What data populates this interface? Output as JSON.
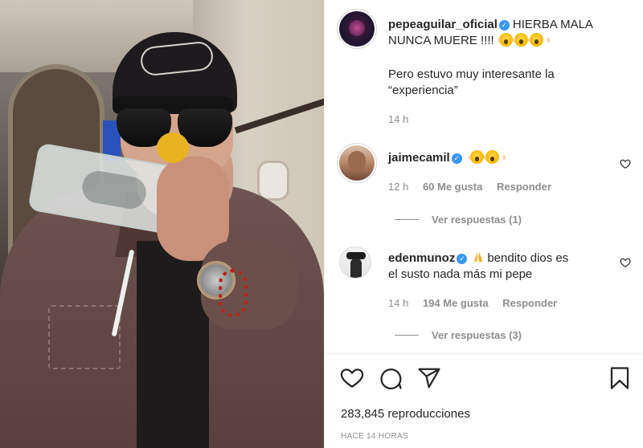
{
  "post": {
    "username": "pepeaguilar_oficial",
    "caption_text": "HIERBA MALA NUNCA MUERE !!!!",
    "caption_extra": "Pero estuvo muy interesante la “experiencia”",
    "time": "14 h"
  },
  "comments": [
    {
      "username": "jaimecamil",
      "text": "",
      "time": "12 h",
      "likes": "60 Me gusta",
      "reply_label": "Responder",
      "view_replies": "Ver respuestas (1)"
    },
    {
      "username": "edenmunoz",
      "text_line1": "bendito dios es",
      "text_line2": "el susto nada más mi pepe",
      "time": "14 h",
      "likes": "194 Me gusta",
      "reply_label": "Responder",
      "view_replies": "Ver respuestas (3)"
    }
  ],
  "footer": {
    "views": "283,845 reproducciones",
    "time_ago": "HACE 14 HORAS"
  },
  "icons": {
    "like": "heart-icon",
    "comment": "comment-icon",
    "share": "share-icon",
    "save": "bookmark-icon",
    "verified": "verified-badge-icon"
  },
  "colors": {
    "verified": "#3897f0",
    "text": "#262626",
    "muted": "#8e8e8e"
  }
}
